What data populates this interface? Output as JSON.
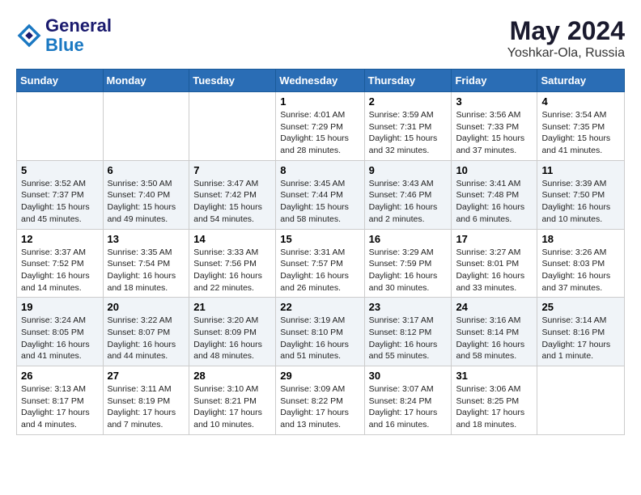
{
  "header": {
    "logo_line1": "General",
    "logo_line2": "Blue",
    "title": "May 2024",
    "subtitle": "Yoshkar-Ola, Russia"
  },
  "weekdays": [
    "Sunday",
    "Monday",
    "Tuesday",
    "Wednesday",
    "Thursday",
    "Friday",
    "Saturday"
  ],
  "weeks": [
    [
      {
        "day": "",
        "info": ""
      },
      {
        "day": "",
        "info": ""
      },
      {
        "day": "",
        "info": ""
      },
      {
        "day": "1",
        "info": "Sunrise: 4:01 AM\nSunset: 7:29 PM\nDaylight: 15 hours\nand 28 minutes."
      },
      {
        "day": "2",
        "info": "Sunrise: 3:59 AM\nSunset: 7:31 PM\nDaylight: 15 hours\nand 32 minutes."
      },
      {
        "day": "3",
        "info": "Sunrise: 3:56 AM\nSunset: 7:33 PM\nDaylight: 15 hours\nand 37 minutes."
      },
      {
        "day": "4",
        "info": "Sunrise: 3:54 AM\nSunset: 7:35 PM\nDaylight: 15 hours\nand 41 minutes."
      }
    ],
    [
      {
        "day": "5",
        "info": "Sunrise: 3:52 AM\nSunset: 7:37 PM\nDaylight: 15 hours\nand 45 minutes."
      },
      {
        "day": "6",
        "info": "Sunrise: 3:50 AM\nSunset: 7:40 PM\nDaylight: 15 hours\nand 49 minutes."
      },
      {
        "day": "7",
        "info": "Sunrise: 3:47 AM\nSunset: 7:42 PM\nDaylight: 15 hours\nand 54 minutes."
      },
      {
        "day": "8",
        "info": "Sunrise: 3:45 AM\nSunset: 7:44 PM\nDaylight: 15 hours\nand 58 minutes."
      },
      {
        "day": "9",
        "info": "Sunrise: 3:43 AM\nSunset: 7:46 PM\nDaylight: 16 hours\nand 2 minutes."
      },
      {
        "day": "10",
        "info": "Sunrise: 3:41 AM\nSunset: 7:48 PM\nDaylight: 16 hours\nand 6 minutes."
      },
      {
        "day": "11",
        "info": "Sunrise: 3:39 AM\nSunset: 7:50 PM\nDaylight: 16 hours\nand 10 minutes."
      }
    ],
    [
      {
        "day": "12",
        "info": "Sunrise: 3:37 AM\nSunset: 7:52 PM\nDaylight: 16 hours\nand 14 minutes."
      },
      {
        "day": "13",
        "info": "Sunrise: 3:35 AM\nSunset: 7:54 PM\nDaylight: 16 hours\nand 18 minutes."
      },
      {
        "day": "14",
        "info": "Sunrise: 3:33 AM\nSunset: 7:56 PM\nDaylight: 16 hours\nand 22 minutes."
      },
      {
        "day": "15",
        "info": "Sunrise: 3:31 AM\nSunset: 7:57 PM\nDaylight: 16 hours\nand 26 minutes."
      },
      {
        "day": "16",
        "info": "Sunrise: 3:29 AM\nSunset: 7:59 PM\nDaylight: 16 hours\nand 30 minutes."
      },
      {
        "day": "17",
        "info": "Sunrise: 3:27 AM\nSunset: 8:01 PM\nDaylight: 16 hours\nand 33 minutes."
      },
      {
        "day": "18",
        "info": "Sunrise: 3:26 AM\nSunset: 8:03 PM\nDaylight: 16 hours\nand 37 minutes."
      }
    ],
    [
      {
        "day": "19",
        "info": "Sunrise: 3:24 AM\nSunset: 8:05 PM\nDaylight: 16 hours\nand 41 minutes."
      },
      {
        "day": "20",
        "info": "Sunrise: 3:22 AM\nSunset: 8:07 PM\nDaylight: 16 hours\nand 44 minutes."
      },
      {
        "day": "21",
        "info": "Sunrise: 3:20 AM\nSunset: 8:09 PM\nDaylight: 16 hours\nand 48 minutes."
      },
      {
        "day": "22",
        "info": "Sunrise: 3:19 AM\nSunset: 8:10 PM\nDaylight: 16 hours\nand 51 minutes."
      },
      {
        "day": "23",
        "info": "Sunrise: 3:17 AM\nSunset: 8:12 PM\nDaylight: 16 hours\nand 55 minutes."
      },
      {
        "day": "24",
        "info": "Sunrise: 3:16 AM\nSunset: 8:14 PM\nDaylight: 16 hours\nand 58 minutes."
      },
      {
        "day": "25",
        "info": "Sunrise: 3:14 AM\nSunset: 8:16 PM\nDaylight: 17 hours\nand 1 minute."
      }
    ],
    [
      {
        "day": "26",
        "info": "Sunrise: 3:13 AM\nSunset: 8:17 PM\nDaylight: 17 hours\nand 4 minutes."
      },
      {
        "day": "27",
        "info": "Sunrise: 3:11 AM\nSunset: 8:19 PM\nDaylight: 17 hours\nand 7 minutes."
      },
      {
        "day": "28",
        "info": "Sunrise: 3:10 AM\nSunset: 8:21 PM\nDaylight: 17 hours\nand 10 minutes."
      },
      {
        "day": "29",
        "info": "Sunrise: 3:09 AM\nSunset: 8:22 PM\nDaylight: 17 hours\nand 13 minutes."
      },
      {
        "day": "30",
        "info": "Sunrise: 3:07 AM\nSunset: 8:24 PM\nDaylight: 17 hours\nand 16 minutes."
      },
      {
        "day": "31",
        "info": "Sunrise: 3:06 AM\nSunset: 8:25 PM\nDaylight: 17 hours\nand 18 minutes."
      },
      {
        "day": "",
        "info": ""
      }
    ]
  ]
}
